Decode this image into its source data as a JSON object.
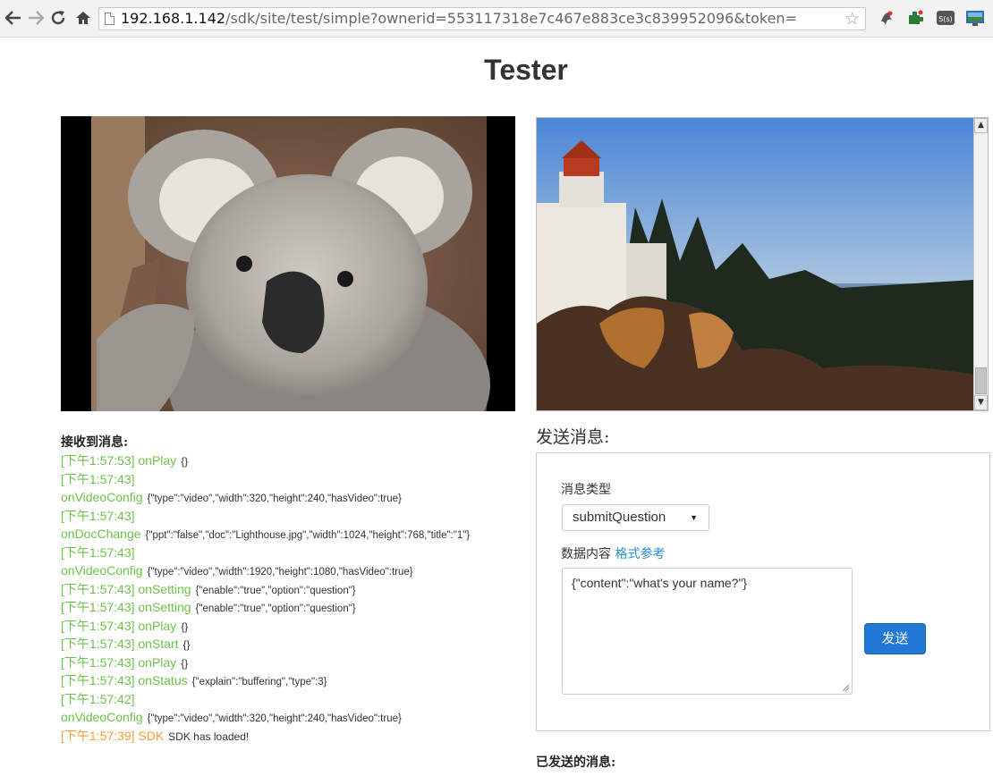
{
  "browser": {
    "url_host": "192.168.1.142",
    "url_rest": "/sdk/site/test/simple?ownerid=553117318e7c467e883ce3c839952096&token="
  },
  "page": {
    "title": "Tester"
  },
  "received": {
    "title": "接收到消息:",
    "lines": [
      {
        "head": "[下午1:57:53] onPlay",
        "json": "{}"
      },
      {
        "head": "[下午1:57:43]",
        "json": ""
      },
      {
        "head": "onVideoConfig",
        "json": "{\"type\":\"video\",\"width\":320,\"height\":240,\"hasVideo\":true}"
      },
      {
        "head": "[下午1:57:43]",
        "json": ""
      },
      {
        "head": "onDocChange",
        "json": "{\"ppt\":\"false\",\"doc\":\"Lighthouse.jpg\",\"width\":1024,\"height\":768,\"title\":\"1\"}"
      },
      {
        "head": "[下午1:57:43]",
        "json": ""
      },
      {
        "head": "onVideoConfig",
        "json": "{\"type\":\"video\",\"width\":1920,\"height\":1080,\"hasVideo\":true}"
      },
      {
        "head": "[下午1:57:43] onSetting",
        "json": "{\"enable\":\"true\",\"option\":\"question\"}"
      },
      {
        "head": "[下午1:57:43] onSetting",
        "json": "{\"enable\":\"true\",\"option\":\"question\"}"
      },
      {
        "head": "[下午1:57:43] onPlay",
        "json": "{}"
      },
      {
        "head": "[下午1:57:43] onStart",
        "json": "{}"
      },
      {
        "head": "[下午1:57:43] onPlay",
        "json": "{}"
      },
      {
        "head": "[下午1:57:43] onStatus",
        "json": "{\"explain\":\"buffering\",\"type\":3}"
      },
      {
        "head": "[下午1:57:42]",
        "json": ""
      },
      {
        "head": "onVideoConfig",
        "json": "{\"type\":\"video\",\"width\":320,\"height\":240,\"hasVideo\":true}"
      }
    ],
    "sdk_line": {
      "head": "[下午1:57:39] SDK",
      "text": "SDK has loaded!"
    }
  },
  "send": {
    "title": "发送消息:",
    "type_label": "消息类型",
    "type_value": "submitQuestion",
    "data_label": "数据内容",
    "data_link": "格式参考",
    "data_value": "{\"content\":\"what's your name?\"}",
    "button": "发送"
  },
  "sent": {
    "title": "已发送的消息:"
  },
  "colors": {
    "log_green": "#6cc24a",
    "log_orange": "#f0a030",
    "link_blue": "#2a8fd6",
    "button_blue": "#2178d4"
  },
  "icons": [
    "back-icon",
    "forward-icon",
    "reload-icon",
    "home-icon",
    "page-icon",
    "star-icon",
    "extension-icon",
    "screen-icon"
  ]
}
